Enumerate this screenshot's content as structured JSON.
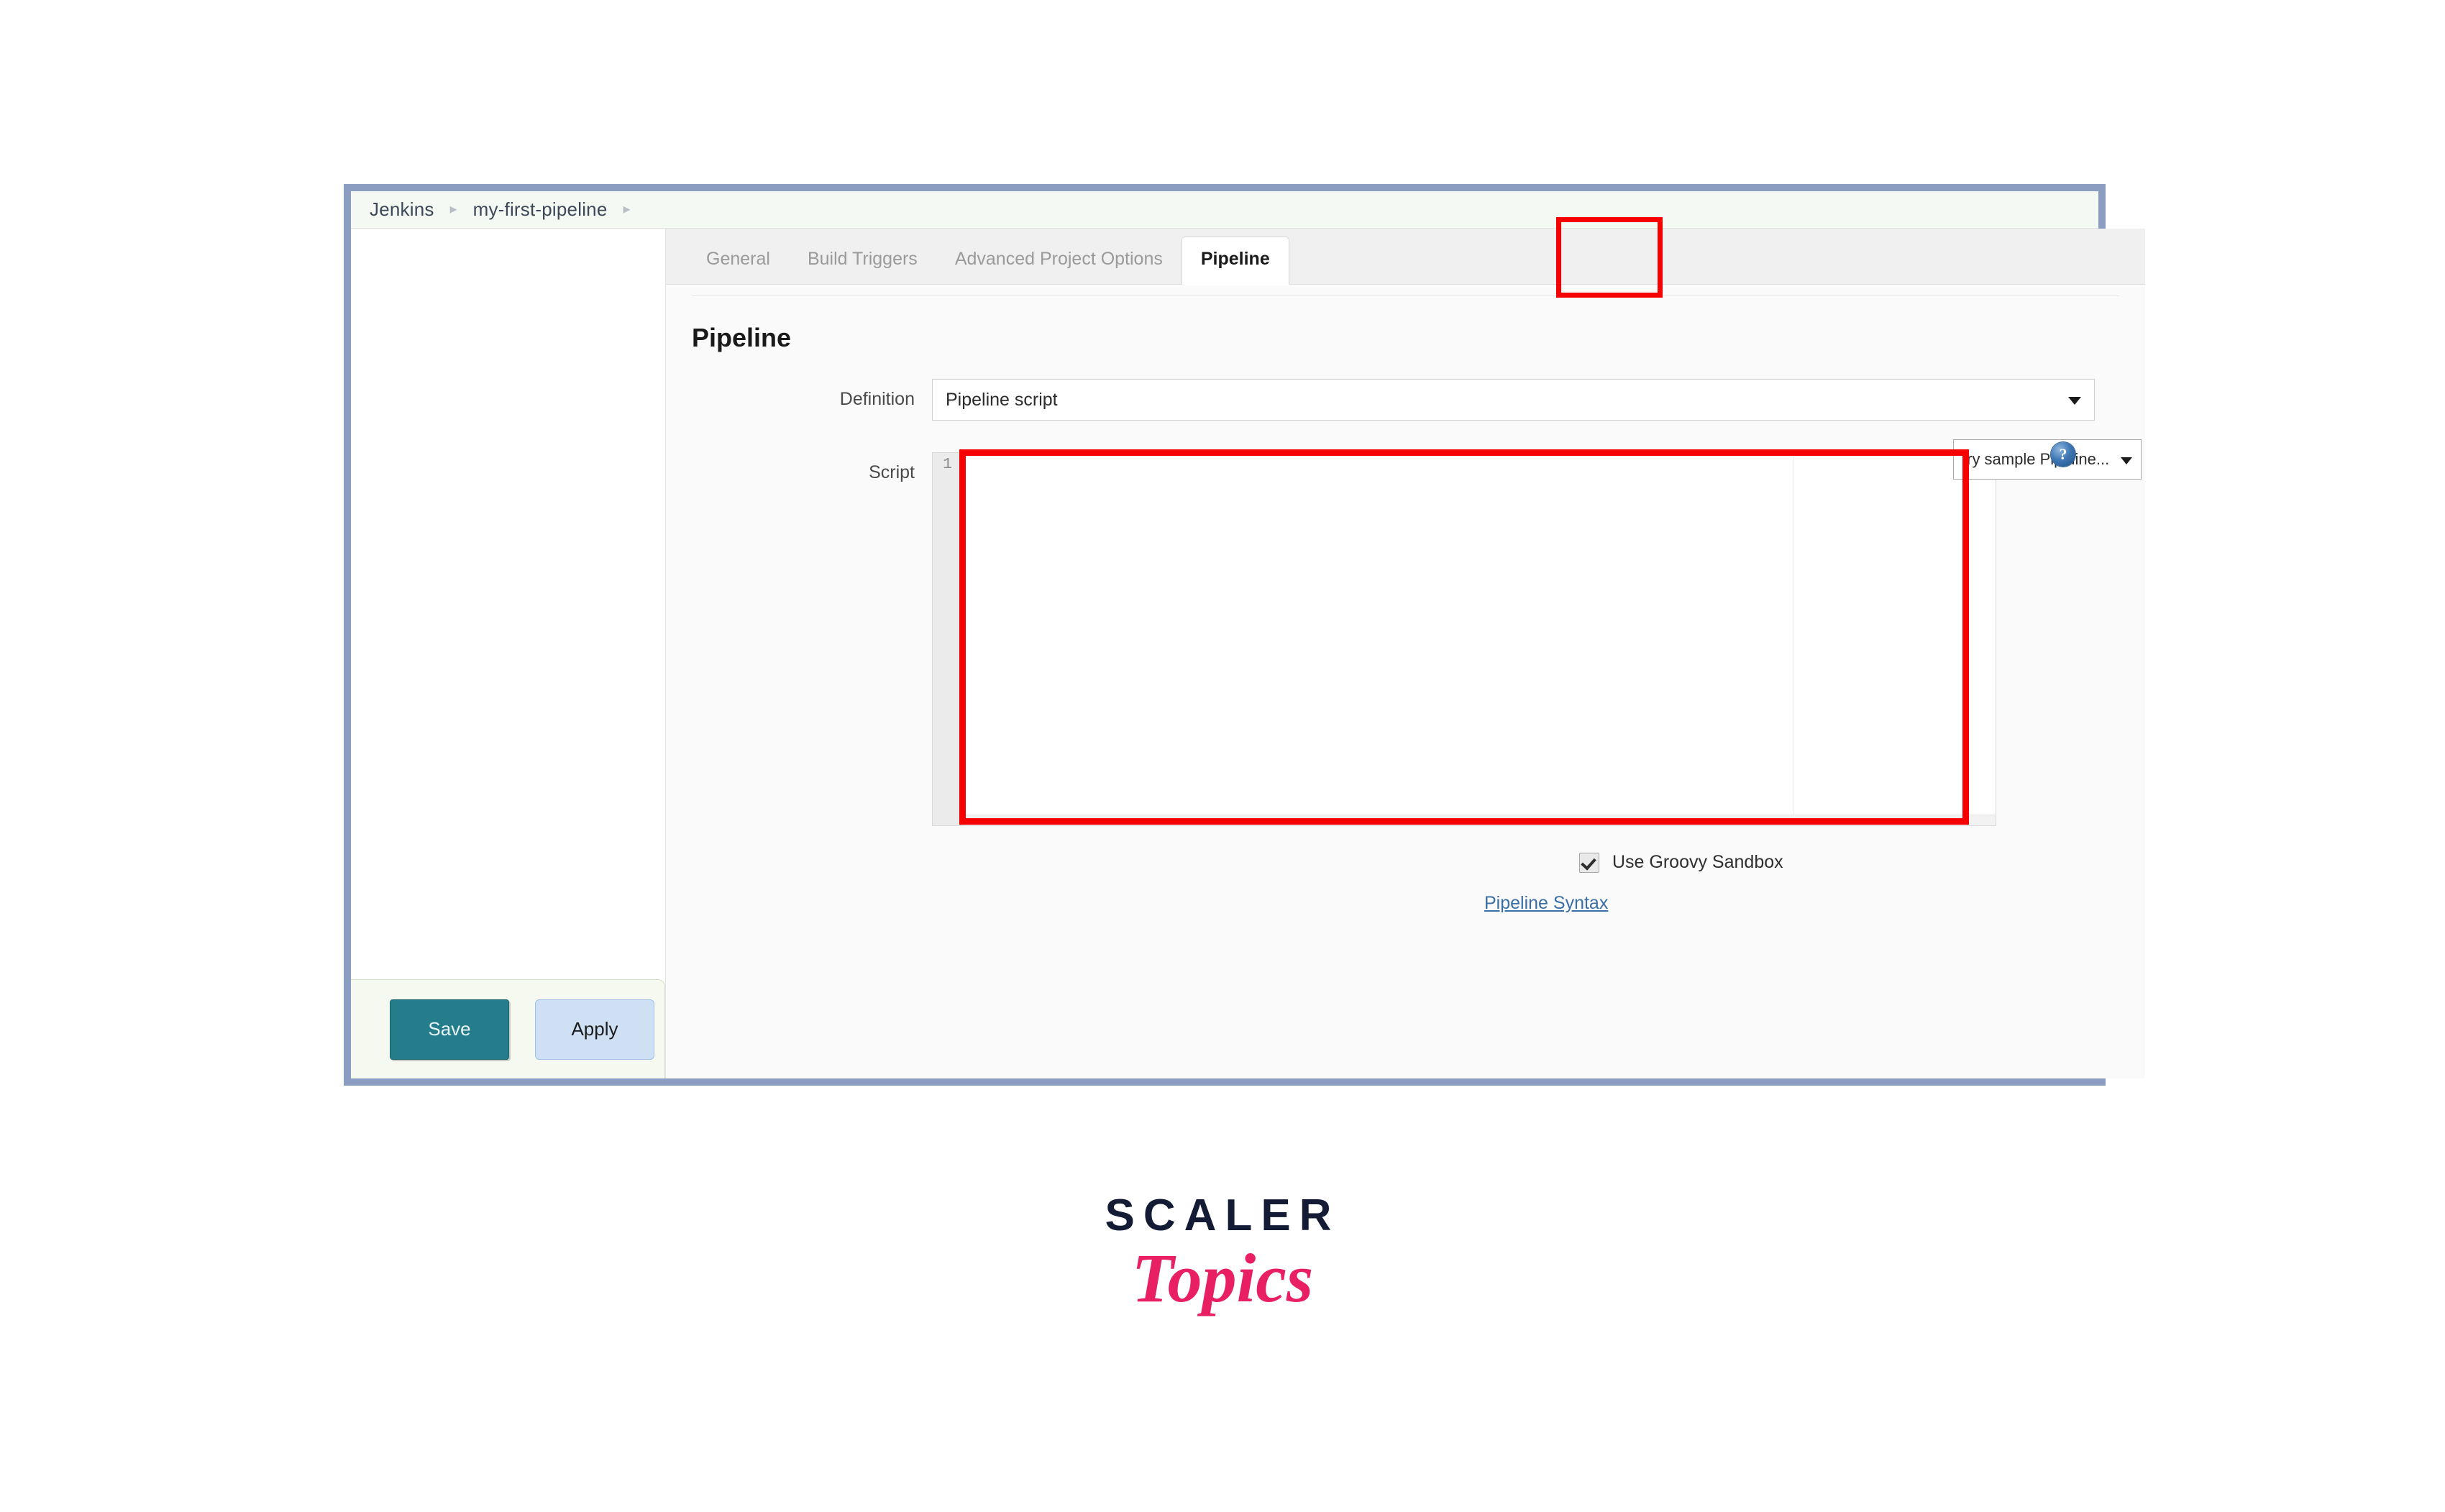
{
  "window": {
    "breadcrumb": {
      "items": [
        "Jenkins",
        "my-first-pipeline"
      ],
      "separator": "▸",
      "trailing_separator": "▸"
    }
  },
  "tabs": [
    {
      "label": "General",
      "active": false
    },
    {
      "label": "Build Triggers",
      "active": false
    },
    {
      "label": "Advanced Project Options",
      "active": false
    },
    {
      "label": "Pipeline",
      "active": true
    }
  ],
  "section": {
    "heading": "Pipeline"
  },
  "definition": {
    "label": "Definition",
    "value": "Pipeline script",
    "caret_icon": "chevron-down-icon"
  },
  "script": {
    "label": "Script",
    "line_number": "1",
    "value": "",
    "sample_dropdown_value": "try sample Pipeline...",
    "sample_caret_icon": "chevron-down-icon",
    "help_icon": "help-icon"
  },
  "sandbox": {
    "label": "Use Groovy Sandbox",
    "checked": true,
    "help_icon": "help-icon"
  },
  "links": {
    "pipeline_syntax": "Pipeline Syntax"
  },
  "actions": {
    "save_label": "Save",
    "apply_label": "Apply"
  },
  "logo": {
    "primary": "SCALER",
    "secondary": "Topics"
  },
  "colors": {
    "window_border": "#8b9dc0",
    "breadcrumb_bg": "#f4faf3",
    "tabbar_bg": "#f0f0f0",
    "annotation_red": "#f70000",
    "save_button_bg": "#257c8b",
    "apply_button_bg": "#cfe0f5",
    "link_blue": "#3a6ea5",
    "logo_primary": "#141b34",
    "logo_secondary": "#e81f63"
  }
}
